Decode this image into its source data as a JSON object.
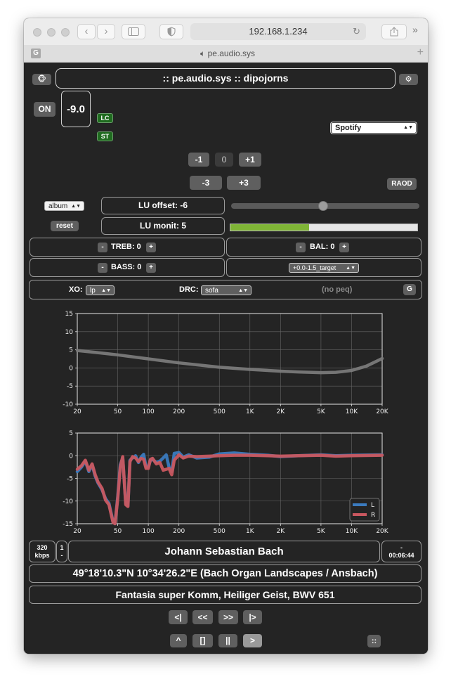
{
  "browser": {
    "url": "192.168.1.234",
    "tab_title": "pe.audio.sys",
    "tab_icon": "G"
  },
  "header": {
    "title": ":: pe.audio.sys :: dipojorns",
    "logo_icon": "monkey-emoji",
    "settings_icon": "gear-icon"
  },
  "power": {
    "label": "ON"
  },
  "volume": {
    "level": "-9.0"
  },
  "badges": {
    "lc": "LC",
    "st": "ST"
  },
  "source": {
    "selected": "Spotify"
  },
  "volume_buttons": {
    "m1": "-1",
    "zero": "0",
    "p1": "+1",
    "m3": "-3",
    "p3": "+3"
  },
  "raod": {
    "label": "RAOD"
  },
  "loudness": {
    "album_select": "album",
    "offset_label": "LU offset: -6",
    "reset_label": "reset",
    "monit_label": "LU monit: 5",
    "slider_fraction": 0.49,
    "meter_fraction": 0.42,
    "meter_color": "#7fb536"
  },
  "tone": {
    "minus": "-",
    "plus": "+",
    "treble": "TREB: 0",
    "bass": "BASS: 0",
    "balance": "BAL: 0",
    "target_select": "+0.0-1.5_target"
  },
  "xo_drc": {
    "xo_label": "XO:",
    "xo_select": "lp",
    "drc_label": "DRC:",
    "drc_select": "sofa",
    "peq_label": "(no peq)",
    "g_label": "G"
  },
  "chart_data": [
    {
      "type": "line",
      "title": "",
      "xscale": "log",
      "xlim": [
        20,
        20000
      ],
      "ylim": [
        -10,
        15
      ],
      "x_ticks": [
        "20",
        "50",
        "100",
        "200",
        "500",
        "1K",
        "2K",
        "5K",
        "10K",
        "20K"
      ],
      "y_ticks": [
        "15",
        "10",
        "5",
        "0",
        "-5",
        "-10"
      ],
      "grid": true,
      "series": [
        {
          "color": "#7a7a7a",
          "x": [
            20,
            30,
            50,
            100,
            200,
            500,
            1000,
            2000,
            3000,
            5000,
            7000,
            10000,
            14000,
            20000
          ],
          "y": [
            4.8,
            4.3,
            3.6,
            2.5,
            1.4,
            0.2,
            -0.4,
            -0.9,
            -1.1,
            -1.3,
            -1.2,
            -0.7,
            0.5,
            2.6
          ]
        }
      ]
    },
    {
      "type": "line",
      "title": "",
      "xscale": "log",
      "xlim": [
        20,
        20000
      ],
      "ylim": [
        -15,
        5
      ],
      "x_ticks": [
        "20",
        "50",
        "100",
        "200",
        "500",
        "1K",
        "2K",
        "5K",
        "10K",
        "20K"
      ],
      "y_ticks": [
        "5",
        "0",
        "-5",
        "-10",
        "-15"
      ],
      "grid": true,
      "legend": "bottom-right",
      "series": [
        {
          "name": "L",
          "color": "#3b7bbf",
          "x": [
            20,
            22,
            24,
            26,
            28,
            30,
            32,
            35,
            38,
            41,
            45,
            47,
            50,
            53,
            56,
            60,
            63,
            66,
            70,
            75,
            80,
            85,
            90,
            95,
            100,
            105,
            110,
            120,
            130,
            140,
            150,
            160,
            170,
            180,
            200,
            220,
            250,
            300,
            400,
            500,
            700,
            1000,
            1500,
            2000,
            3000,
            5000,
            7000,
            10000,
            20000
          ],
          "y": [
            -3.5,
            -2.5,
            -1.2,
            -3.5,
            -2.0,
            -4.5,
            -6.0,
            -7.5,
            -9.5,
            -10.5,
            -14.5,
            -15.0,
            -9.0,
            -2.0,
            -0.5,
            -10.5,
            -11.0,
            -1.0,
            -0.5,
            0.0,
            -1.5,
            -0.3,
            0.3,
            -2.5,
            -2.5,
            -1.0,
            -0.8,
            -1.5,
            -1.2,
            -0.5,
            0.2,
            -2.5,
            -3.5,
            0.5,
            0.7,
            -0.3,
            0.2,
            -0.5,
            -0.3,
            0.4,
            0.6,
            0.3,
            0.1,
            -0.2,
            0.0,
            0.2,
            0.0,
            0.1,
            0.2
          ]
        },
        {
          "name": "R",
          "color": "#c9575f",
          "x": [
            20,
            22,
            24,
            26,
            28,
            30,
            32,
            35,
            38,
            41,
            45,
            47,
            50,
            53,
            56,
            60,
            63,
            66,
            70,
            75,
            80,
            85,
            90,
            95,
            100,
            105,
            110,
            120,
            130,
            140,
            150,
            160,
            170,
            180,
            200,
            220,
            250,
            300,
            400,
            500,
            700,
            1000,
            1500,
            2000,
            3000,
            5000,
            7000,
            10000,
            20000
          ],
          "y": [
            -3.0,
            -2.2,
            -1.0,
            -3.2,
            -1.8,
            -4.2,
            -5.8,
            -7.2,
            -9.8,
            -10.8,
            -14.7,
            -15.0,
            -9.5,
            -2.5,
            -0.2,
            -10.8,
            -11.2,
            -1.3,
            -0.2,
            -0.5,
            -1.3,
            -0.6,
            -0.8,
            -2.8,
            -2.8,
            -0.8,
            -0.6,
            -1.8,
            -1.5,
            -3.2,
            -3.0,
            -2.8,
            -4.2,
            -1.0,
            0.2,
            -0.5,
            -0.1,
            -0.2,
            -0.1,
            0.0,
            0.1,
            0.1,
            0.0,
            -0.1,
            0.0,
            0.1,
            -0.1,
            0.0,
            0.1
          ]
        }
      ]
    }
  ],
  "now_playing": {
    "bitrate_value": "320",
    "bitrate_unit": "kbps",
    "track_num": "1",
    "track_total": "-",
    "artist": "Johann Sebastian Bach",
    "time_top": "-",
    "time": "00:06:44",
    "album": "49°18'10.3\"N 10°34'26.2\"E (Bach Organ Landscapes / Ansbach)",
    "track": "Fantasia super Komm, Heiliger Geist, BWV 651"
  },
  "transport": {
    "prev": "<|",
    "rew": "<<",
    "ff": ">>",
    "next": "|>",
    "eject": "^",
    "stop": "[]",
    "pause": "||",
    "play": ">",
    "more": "::"
  }
}
